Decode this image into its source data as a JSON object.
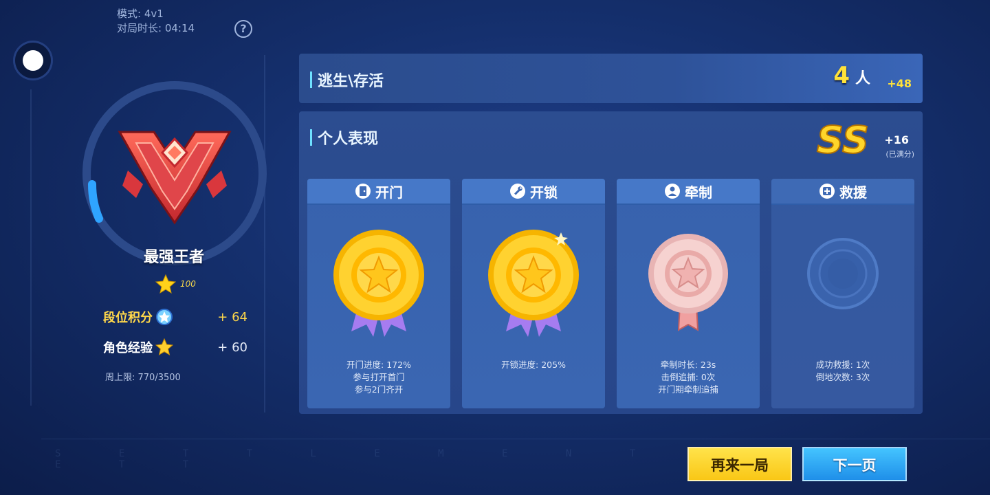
{
  "meta": {
    "mode": "模式: 4v1",
    "duration": "对局时长: 04:14",
    "help_icon": "question-mark-icon"
  },
  "rank": {
    "name": "最强王者",
    "stars": "100",
    "rank_points_label": "段位积分",
    "rank_points_value": "+ 64",
    "exp_label": "角色经验",
    "exp_value": "+ 60",
    "weekly_limit": "周上限: 770/3500"
  },
  "escape": {
    "title": "逃生\\存活",
    "count": "4",
    "unit": "人",
    "bonus": "+48"
  },
  "performance": {
    "title": "个人表现",
    "grade": "SS",
    "bonus": "+16",
    "note": "(已满分)",
    "cards": [
      {
        "title": "开门",
        "icon": "door-icon",
        "medal": "gold",
        "stats": [
          "开门进度: 172%",
          "参与打开首门",
          "参与2门齐开"
        ]
      },
      {
        "title": "开锁",
        "icon": "wrench-icon",
        "medal": "gold",
        "stats": [
          "开锁进度: 205%"
        ]
      },
      {
        "title": "牵制",
        "icon": "person-icon",
        "medal": "bronze",
        "stats": [
          "牵制时长: 23s",
          "击倒追捕: 0次",
          "开门期牵制追捕"
        ]
      },
      {
        "title": "救援",
        "icon": "rescue-plus-icon",
        "medal": "none",
        "stats": [
          "成功救援: 1次",
          "倒地次数: 3次"
        ]
      }
    ]
  },
  "buttons": {
    "play_again": "再来一局",
    "next_page": "下一页"
  },
  "watermark": "S E T T L E M E N T   S E T T"
}
